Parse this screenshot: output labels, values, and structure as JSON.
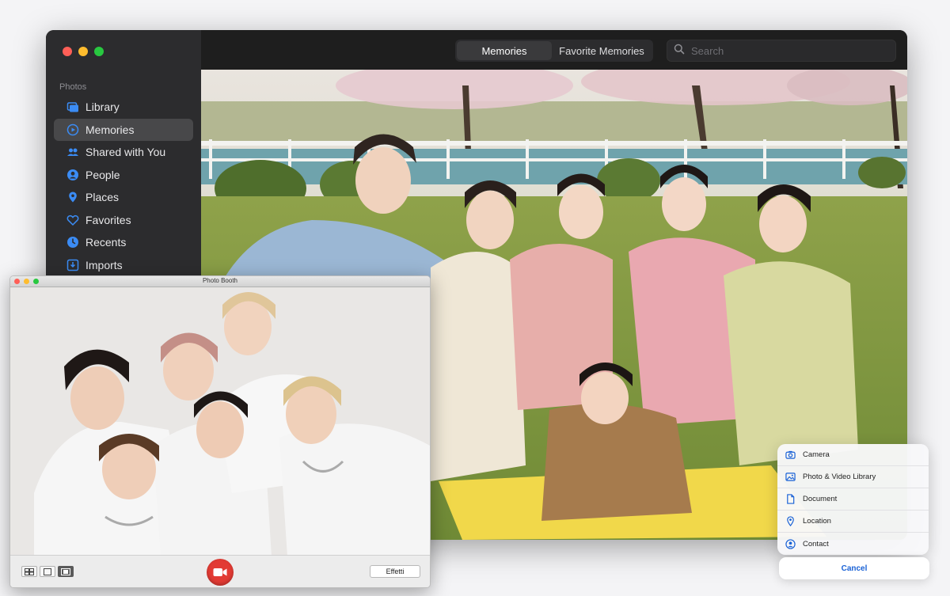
{
  "photos": {
    "sidebar": {
      "section_title": "Photos",
      "items": [
        {
          "label": "Library",
          "icon": "library-icon"
        },
        {
          "label": "Memories",
          "icon": "memories-icon",
          "active": true
        },
        {
          "label": "Shared with You",
          "icon": "shared-icon"
        },
        {
          "label": "People",
          "icon": "people-icon"
        },
        {
          "label": "Places",
          "icon": "places-icon"
        },
        {
          "label": "Favorites",
          "icon": "heart-icon"
        },
        {
          "label": "Recents",
          "icon": "clock-icon"
        },
        {
          "label": "Imports",
          "icon": "import-icon"
        }
      ]
    },
    "toolbar": {
      "tabs": [
        {
          "label": "Memories",
          "active": true
        },
        {
          "label": "Favorite Memories",
          "active": false
        }
      ],
      "search_placeholder": "Search"
    },
    "accent_color": "#3b8cf5"
  },
  "photo_booth": {
    "title": "Photo Booth",
    "effects_label": "Effetti",
    "record_color": "#e23b34"
  },
  "share_sheet": {
    "items": [
      {
        "label": "Camera",
        "icon": "camera-icon"
      },
      {
        "label": "Photo & Video Library",
        "icon": "photo-library-icon"
      },
      {
        "label": "Document",
        "icon": "document-icon"
      },
      {
        "label": "Location",
        "icon": "location-icon"
      },
      {
        "label": "Contact",
        "icon": "contact-icon"
      }
    ],
    "cancel_label": "Cancel",
    "accent_color": "#1a62d6"
  }
}
